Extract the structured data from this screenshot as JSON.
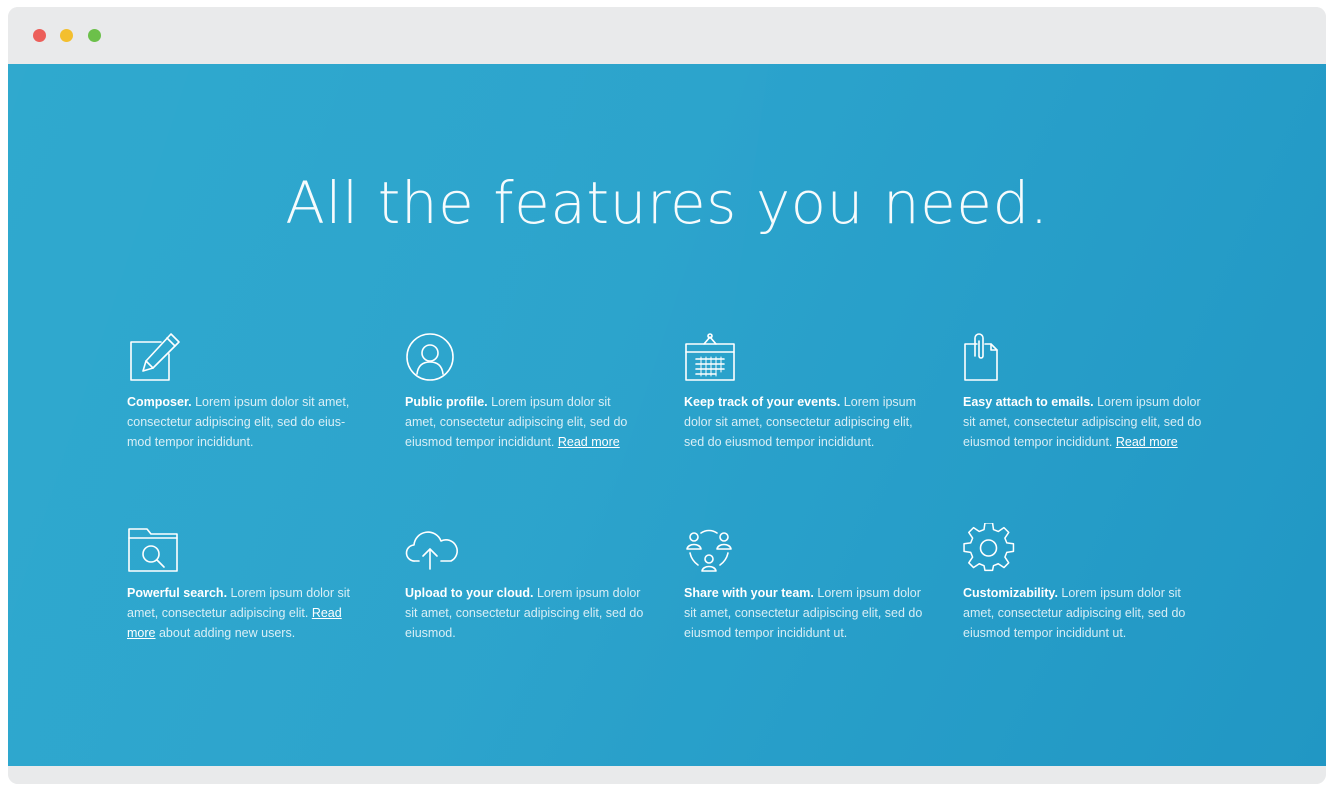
{
  "window": {
    "controls": {
      "close_color": "#ec5f5a",
      "minimize_color": "#f3bf2e",
      "maximize_color": "#6cc04a"
    }
  },
  "main": {
    "headline": "All the features you need.",
    "background_color": "#2aa5cc",
    "features": [
      {
        "icon": "pencil-edit-icon",
        "title": "Composer.",
        "text": "Lorem ipsum dolor sit amet, consectetur adipiscing elit, sed do eius-mod tempor incididunt.",
        "link": "",
        "after_link": ""
      },
      {
        "icon": "user-profile-icon",
        "title": "Public profile.",
        "text": "Lorem ipsum dolor sit amet, consectetur adipiscing elit, sed do eiusmod tempor incididunt.",
        "link": "Read more",
        "after_link": ""
      },
      {
        "icon": "calendar-icon",
        "title": "Keep track of your events.",
        "text": "Lorem ipsum dolor sit amet, consectetur adipiscing elit, sed do eiusmod tempor incididunt.",
        "link": "",
        "after_link": ""
      },
      {
        "icon": "paperclip-document-icon",
        "title": "Easy attach to emails.",
        "text": "Lorem ipsum dolor sit amet, consectetur adipiscing elit, sed do eiusmod tempor incididunt.",
        "link": "Read more",
        "after_link": ""
      },
      {
        "icon": "folder-search-icon",
        "title": "Powerful search.",
        "text": "Lorem ipsum dolor sit amet, consectetur adipiscing elit.",
        "link": "Read more",
        "after_link": "about adding new users."
      },
      {
        "icon": "cloud-upload-icon",
        "title": "Upload to your cloud.",
        "text": "Lorem ipsum dolor sit amet, consectetur adipiscing elit, sed do eiusmod.",
        "link": "",
        "after_link": ""
      },
      {
        "icon": "team-share-icon",
        "title": "Share with your team.",
        "text": "Lorem ipsum dolor sit amet, consectetur adipiscing elit, sed do eiusmod tempor incididunt ut.",
        "link": "",
        "after_link": ""
      },
      {
        "icon": "gear-icon",
        "title": "Customizability.",
        "text": "Lorem ipsum dolor sit amet, consectetur adipiscing elit, sed do eiusmod tempor incididunt ut.",
        "link": "",
        "after_link": ""
      }
    ]
  }
}
